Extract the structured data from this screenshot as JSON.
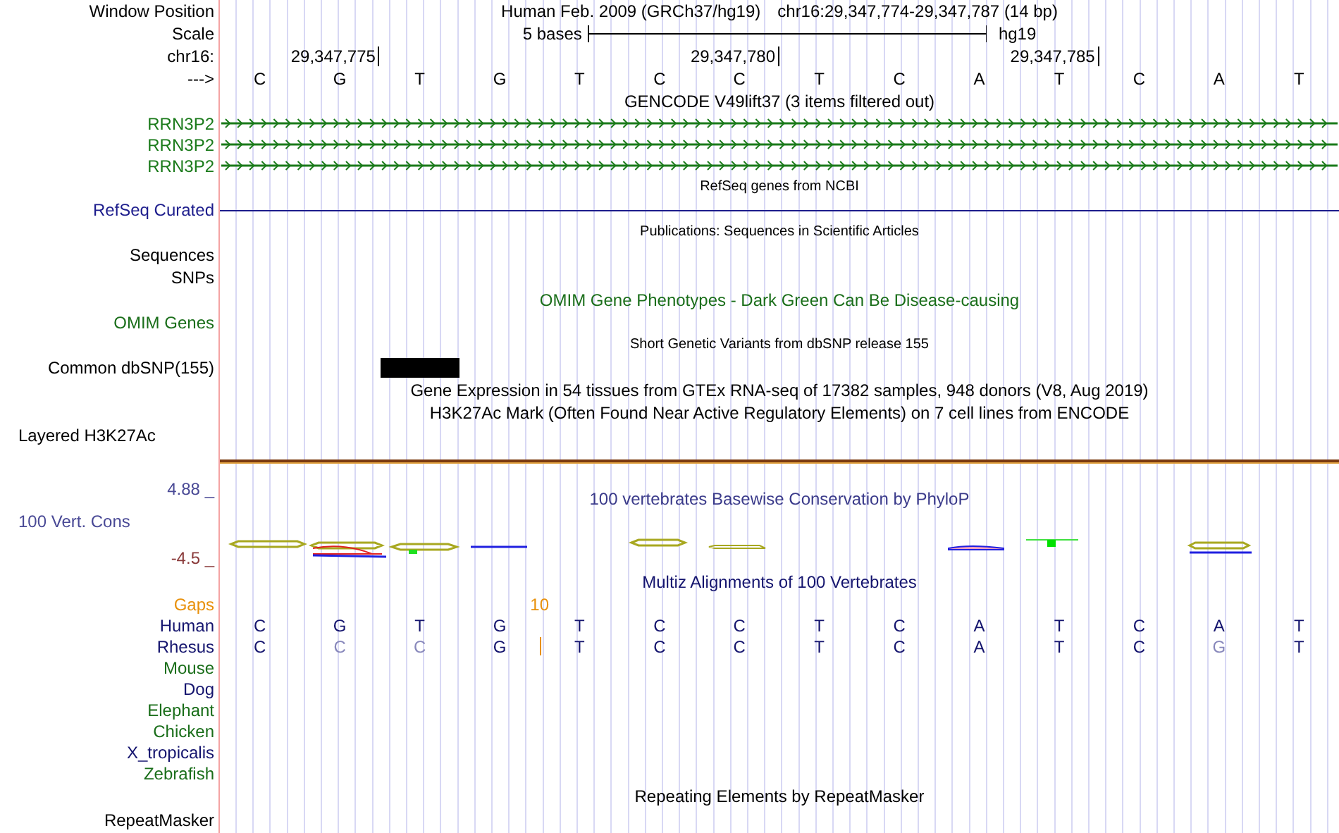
{
  "position": {
    "label": "Window Position",
    "assembly": "Human Feb. 2009 (GRCh37/hg19)",
    "range": "chr16:29,347,774-29,347,787 (14 bp)"
  },
  "scale": {
    "label": "Scale",
    "text": "5 bases",
    "db": "hg19"
  },
  "ruler": {
    "label": "chr16:"
  },
  "sequence": {
    "label": "--->",
    "bases": [
      {
        "letter": "C"
      },
      {
        "letter": "G",
        "tick": "29,347,775"
      },
      {
        "letter": "T"
      },
      {
        "letter": "G"
      },
      {
        "letter": "T"
      },
      {
        "letter": "C"
      },
      {
        "letter": "C",
        "tick": "29,347,780"
      },
      {
        "letter": "T"
      },
      {
        "letter": "C"
      },
      {
        "letter": "A"
      },
      {
        "letter": "T",
        "tick": "29,347,785"
      },
      {
        "letter": "C"
      },
      {
        "letter": "A"
      },
      {
        "letter": "T"
      }
    ]
  },
  "tracks": [
    {
      "kind": "title",
      "text": "GENCODE V49lift37 (3 items filtered out)",
      "color": "#000000"
    },
    {
      "kind": "gene",
      "label": "RRN3P2",
      "color": "#1a7a1a"
    },
    {
      "kind": "gene",
      "label": "RRN3P2",
      "color": "#1a7a1a"
    },
    {
      "kind": "gene",
      "label": "RRN3P2",
      "color": "#1a7a1a"
    },
    {
      "kind": "small_title",
      "text": "RefSeq genes from NCBI"
    },
    {
      "kind": "line",
      "label": "RefSeq Curated",
      "color": "#1c1c8c"
    },
    {
      "kind": "small_title",
      "text": "Publications: Sequences in Scientific Articles"
    },
    {
      "kind": "label",
      "label": "Sequences"
    },
    {
      "kind": "label",
      "label": "SNPs"
    },
    {
      "kind": "title",
      "text": "OMIM Gene Phenotypes - Dark Green Can Be Disease-causing",
      "color": "#1a6e1a"
    },
    {
      "kind": "label",
      "label": "OMIM Genes",
      "color": "#1a6e1a"
    },
    {
      "kind": "small_title",
      "text": "Short Genetic Variants from dbSNP release 155"
    },
    {
      "kind": "snp",
      "label": "Common dbSNP(155)",
      "marks": [
        false,
        false,
        true,
        false,
        false,
        false,
        false,
        false,
        false,
        false,
        false,
        false,
        false,
        false
      ]
    },
    {
      "kind": "title",
      "text": "Gene Expression in 54 tissues from GTEx RNA-seq of 17382 samples, 948 donors (V8, Aug 2019)",
      "color": "#000000"
    },
    {
      "kind": "title",
      "text": "H3K27Ac Mark (Often Found Near Active Regulatory Elements) on 7 cell lines from ENCODE",
      "color": "#000000"
    },
    {
      "kind": "composite_label",
      "label": "Layered H3K27Ac"
    },
    {
      "kind": "rule"
    },
    {
      "kind": "wiggle",
      "top": "4.88 _",
      "label": "100 Vert. Cons",
      "bottom": "-4.5 _",
      "title": "100 vertebrates Basewise Conservation by PhyloP"
    },
    {
      "kind": "title",
      "text": "Multiz Alignments of 100 Vertebrates",
      "color": "#14146e"
    },
    {
      "kind": "gaps",
      "label": "Gaps",
      "color": "#e8900a",
      "count": "10"
    },
    {
      "kind": "species",
      "label": "Human",
      "color": "#14146e",
      "bases": [
        {
          "letter": "C",
          "faded": false
        },
        {
          "letter": "G",
          "faded": false
        },
        {
          "letter": "T",
          "faded": false
        },
        {
          "letter": "G",
          "faded": false
        },
        {
          "letter": "T",
          "faded": false
        },
        {
          "letter": "C",
          "faded": false
        },
        {
          "letter": "C",
          "faded": false
        },
        {
          "letter": "T",
          "faded": false
        },
        {
          "letter": "C",
          "faded": false
        },
        {
          "letter": "A",
          "faded": false
        },
        {
          "letter": "T",
          "faded": false
        },
        {
          "letter": "C",
          "faded": false
        },
        {
          "letter": "A",
          "faded": false
        },
        {
          "letter": "T",
          "faded": false
        }
      ]
    },
    {
      "kind": "species",
      "label": "Rhesus",
      "color": "#14146e",
      "bases": [
        {
          "letter": "C",
          "faded": false
        },
        {
          "letter": "C",
          "faded": true
        },
        {
          "letter": "C",
          "faded": true
        },
        {
          "letter": "G",
          "faded": false,
          "insertion_after": true
        },
        {
          "letter": "T",
          "faded": false
        },
        {
          "letter": "C",
          "faded": false
        },
        {
          "letter": "C",
          "faded": false
        },
        {
          "letter": "T",
          "faded": false
        },
        {
          "letter": "C",
          "faded": false
        },
        {
          "letter": "A",
          "faded": false
        },
        {
          "letter": "T",
          "faded": false
        },
        {
          "letter": "C",
          "faded": false
        },
        {
          "letter": "G",
          "faded": true
        },
        {
          "letter": "T",
          "faded": false
        }
      ]
    },
    {
      "kind": "species",
      "label": "Mouse",
      "color": "#1a6e1a"
    },
    {
      "kind": "species",
      "label": "Dog",
      "color": "#14146e"
    },
    {
      "kind": "species",
      "label": "Elephant",
      "color": "#1a6e1a"
    },
    {
      "kind": "species",
      "label": "Chicken",
      "color": "#1a6e1a"
    },
    {
      "kind": "species",
      "label": "X_tropicalis",
      "color": "#14146e"
    },
    {
      "kind": "species",
      "label": "Zebrafish",
      "color": "#1a6e1a"
    },
    {
      "kind": "title",
      "text": "Repeating Elements by RepeatMasker",
      "color": "#000000"
    },
    {
      "kind": "label",
      "label": "RepeatMasker"
    }
  ]
}
